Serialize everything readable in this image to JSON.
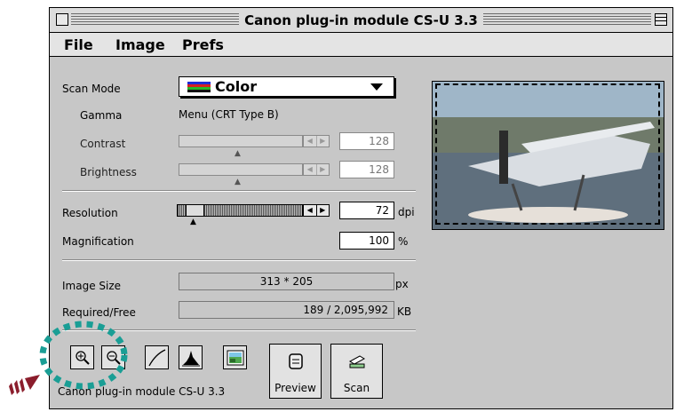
{
  "window": {
    "title": "Canon plug-in module CS-U 3.3"
  },
  "menubar": {
    "items": [
      "File",
      "Image",
      "Prefs"
    ]
  },
  "scan_mode": {
    "label": "Scan Mode",
    "value": "Color"
  },
  "gamma": {
    "label": "Gamma",
    "value": "Menu (CRT Type B)"
  },
  "contrast": {
    "label": "Contrast",
    "value": "128",
    "level": 0.5
  },
  "brightness": {
    "label": "Brightness",
    "value": "128",
    "level": 0.5
  },
  "resolution": {
    "label": "Resolution",
    "value": "72",
    "unit": "dpi",
    "level": 0.1
  },
  "magnification": {
    "label": "Magnification",
    "value": "100",
    "unit": "%"
  },
  "image_size": {
    "label": "Image Size",
    "value": "313 * 205",
    "unit": "px"
  },
  "required_free": {
    "label": "Required/Free",
    "value": "189 / 2,095,992",
    "unit": "KB"
  },
  "toolbar": {
    "zoom_in": "zoom-in",
    "zoom_out": "zoom-out",
    "curve": "tone-curve",
    "histogram": "histogram",
    "color": "color-balance"
  },
  "buttons": {
    "preview": "Preview",
    "scan": "Scan"
  },
  "status": {
    "text": "Canon plug-in module CS-U 3.3"
  },
  "colors": {
    "window_bg": "#c7c7c7",
    "highlight": "#1a9e95",
    "arrow": "#8b1d2c"
  },
  "icons": {
    "close": "close-box-icon",
    "zoom": "zoom-box-icon",
    "popup": "triangle-down-icon",
    "scanmode": "color-bars-icon",
    "pointer": "arrow-icon"
  }
}
